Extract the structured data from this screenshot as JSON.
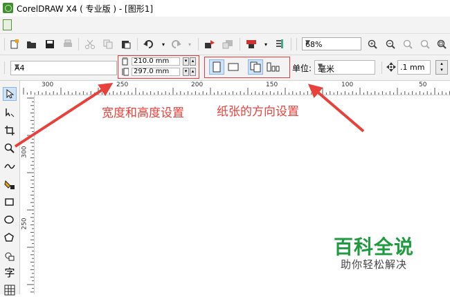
{
  "window": {
    "title": "CorelDRAW X4 ( 专业版 ) - [图形1]"
  },
  "toolbar": {
    "zoom_value": "68%"
  },
  "property_bar": {
    "paper_size": "A4",
    "width": "210.0 mm",
    "height": "297.0 mm",
    "units_label": "单位:",
    "units_value": "毫米",
    "nudge_value": ".1 mm"
  },
  "rulers": {
    "horizontal_ticks": [
      "300",
      "250",
      "200",
      "150",
      "100",
      "50"
    ],
    "vertical_ticks": [
      "300",
      "250"
    ]
  },
  "annotations": {
    "size_label": "宽度和高度设置",
    "orientation_label": "纸张的方向设置"
  },
  "watermark": {
    "title": "百科全说",
    "subtitle": "助你轻松解决"
  },
  "colors": {
    "annotation_red": "#e8403a",
    "watermark_green": "#1f9b3f",
    "selection_blue": "#cfe3f7"
  }
}
